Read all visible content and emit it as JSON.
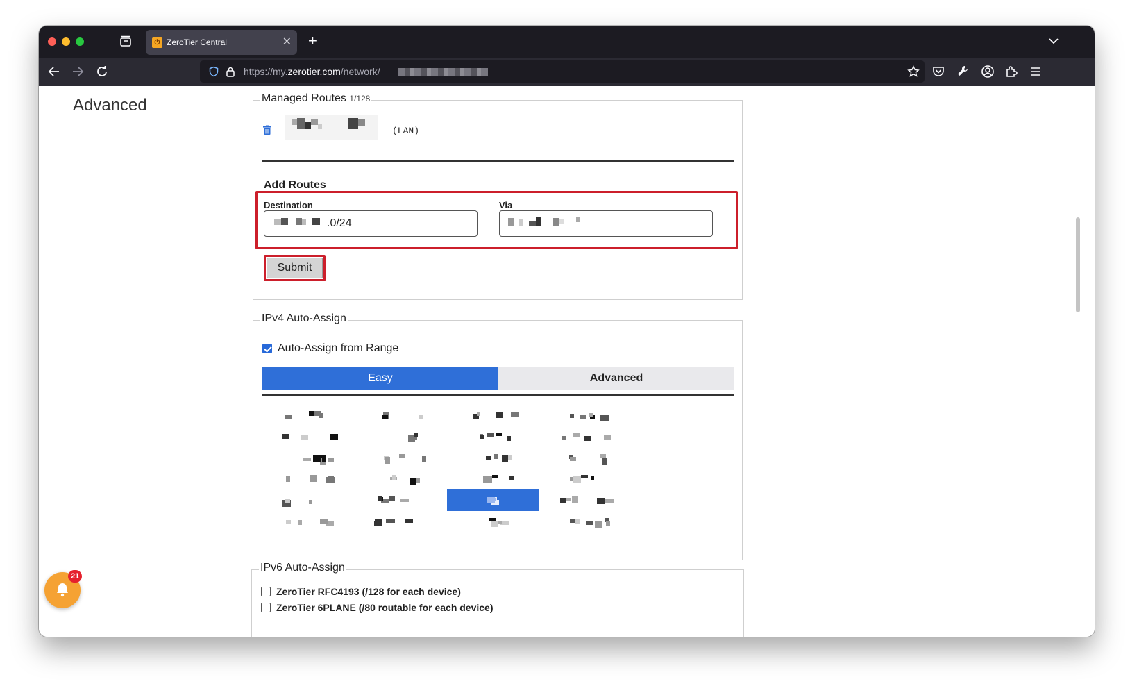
{
  "browser": {
    "tab_title": "ZeroTier Central",
    "url_prefix": "https://my.",
    "url_domain": "zerotier.com",
    "url_path": "/network/"
  },
  "page": {
    "section_title": "Advanced",
    "managed_routes": {
      "legend": "Managed Routes",
      "count": "1/128",
      "routes": [
        {
          "via_label": "(LAN)"
        }
      ]
    },
    "add_routes": {
      "title": "Add Routes",
      "destination_label": "Destination",
      "destination_visible_suffix": ".0/24",
      "via_label": "Via",
      "submit_label": "Submit"
    },
    "ipv4": {
      "legend": "IPv4 Auto-Assign",
      "auto_assign_label": "Auto-Assign from Range",
      "auto_assign_checked": true,
      "tabs": [
        {
          "label": "Easy",
          "active": true
        },
        {
          "label": "Advanced",
          "active": false
        }
      ],
      "range_grid": {
        "columns": 4,
        "rows": 6,
        "selected_row": 4,
        "selected_col": 2
      }
    },
    "ipv6": {
      "legend": "IPv6 Auto-Assign",
      "options": [
        {
          "label": "ZeroTier RFC4193 (/128 for each device)",
          "checked": false
        },
        {
          "label": "ZeroTier 6PLANE (/80 routable for each device)",
          "checked": false
        }
      ]
    },
    "notifications": {
      "count": "21"
    }
  },
  "colors": {
    "accent": "#2f6fd8",
    "highlight": "#cc1f2b",
    "notification": "#f5a233",
    "badge": "#e5212d"
  }
}
